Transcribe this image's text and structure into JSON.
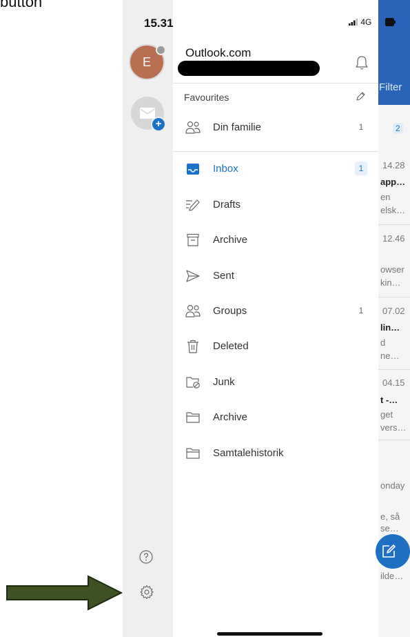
{
  "page_top_text": "button",
  "status_bar": {
    "time": "15.31",
    "network": "4G"
  },
  "rail": {
    "avatar_letter": "E",
    "colors": {
      "avatar": "#b86f52",
      "add_badge": "#1a73c9"
    },
    "icons": [
      "mail-icon",
      "plus-icon",
      "help-icon",
      "gear-icon"
    ]
  },
  "drawer": {
    "account_title": "Outlook.com",
    "favourites_label": "Favourites",
    "favourites": [
      {
        "label": "Din familie",
        "count": "1",
        "icon": "groups-icon"
      }
    ],
    "folders": [
      {
        "label": "Inbox",
        "count": "1",
        "icon": "inbox-icon",
        "selected": true
      },
      {
        "label": "Drafts",
        "count": "",
        "icon": "drafts-icon"
      },
      {
        "label": "Archive",
        "count": "",
        "icon": "archive-icon"
      },
      {
        "label": "Sent",
        "count": "",
        "icon": "sent-icon"
      },
      {
        "label": "Groups",
        "count": "1",
        "icon": "groups-icon"
      },
      {
        "label": "Deleted",
        "count": "",
        "icon": "trash-icon"
      },
      {
        "label": "Junk",
        "count": "",
        "icon": "junk-icon"
      },
      {
        "label": "Archive",
        "count": "",
        "icon": "folder-icon"
      },
      {
        "label": "Samtalehistorik",
        "count": "",
        "icon": "folder-icon"
      }
    ],
    "accent_color": "#1a73c9"
  },
  "background_list": {
    "filter_label": "Filter",
    "badge": "2",
    "fragments": [
      "14.28",
      "app…",
      "en",
      "elsk…",
      "12.46",
      "owser",
      "kin…",
      "07.02",
      "lin…",
      "d",
      "ne…",
      "04.15",
      "t -…",
      "get",
      "vers…",
      "onday",
      "e, så",
      "se…",
      "ilde…"
    ]
  },
  "annotation": {
    "arrow_color": "#3f5224",
    "points_to": "gear-icon"
  }
}
